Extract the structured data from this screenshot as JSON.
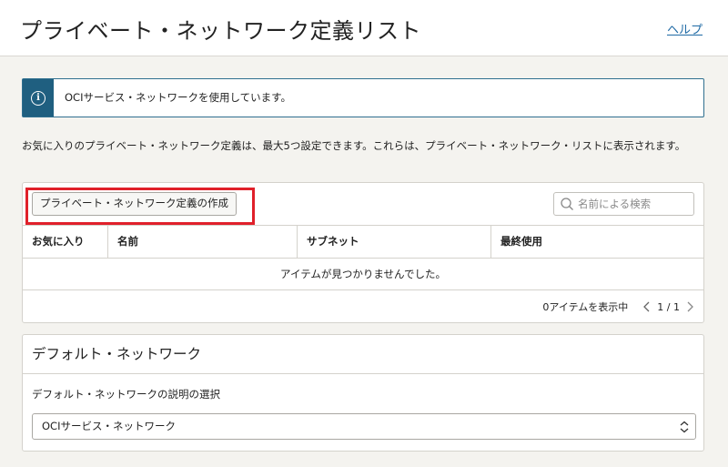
{
  "header": {
    "title": "プライベート・ネットワーク定義リスト",
    "help_label": "ヘルプ"
  },
  "info_banner": {
    "icon": "info-icon",
    "message": "OCIサービス・ネットワークを使用しています。",
    "accent_color": "#1f5f80"
  },
  "description": "お気に入りのプライベート・ネットワーク定義は、最大5つ設定できます。これらは、プライベート・ネットワーク・リストに表示されます。",
  "definitions_panel": {
    "create_button_label": "プライベート・ネットワーク定義の作成",
    "highlight_color": "#e0202a",
    "search": {
      "placeholder": "名前による検索",
      "value": ""
    },
    "columns": [
      "お気に入り",
      "名前",
      "サブネット",
      "最終使用"
    ],
    "empty_message": "アイテムが見つかりませんでした。",
    "item_count_label": "0アイテムを表示中",
    "pagination": "1 / 1"
  },
  "default_network_panel": {
    "title": "デフォルト・ネットワーク",
    "field_label": "デフォルト・ネットワークの説明の選択",
    "selected_value": "OCIサービス・ネットワーク"
  }
}
